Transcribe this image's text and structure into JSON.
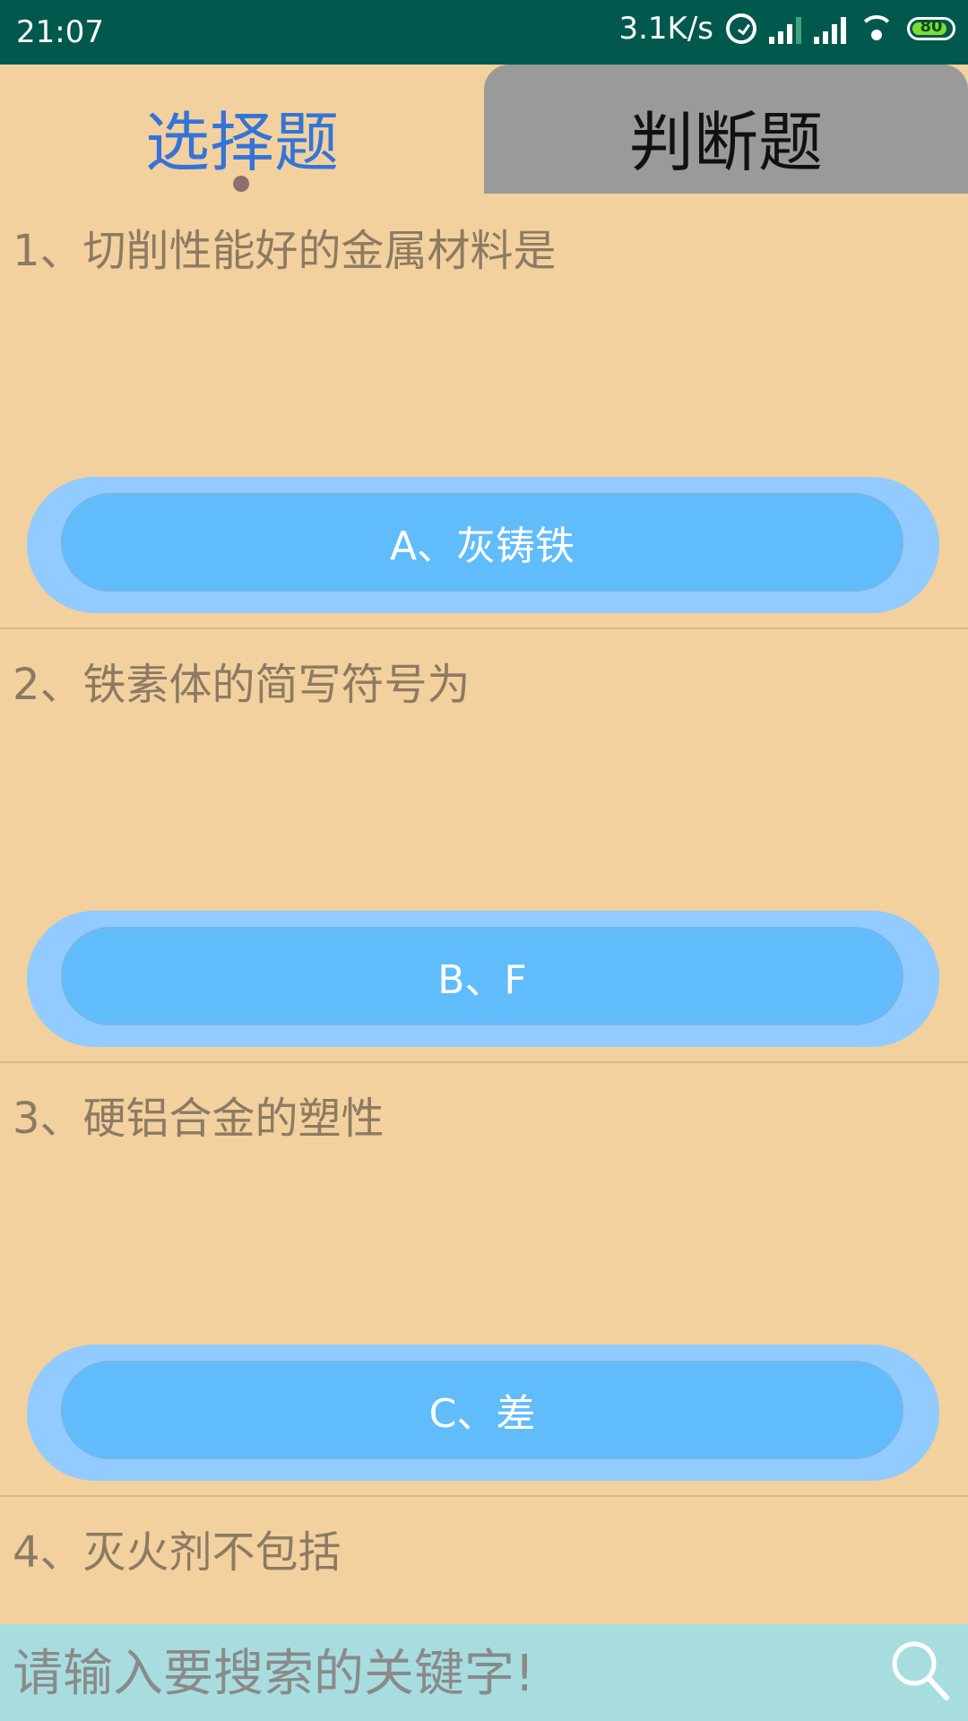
{
  "status_bar": {
    "time": "21:07",
    "network_speed": "3.1K/s",
    "battery": "80",
    "icons": [
      "alarm-icon",
      "signal-icon",
      "signal-icon",
      "wifi-icon",
      "battery-icon"
    ]
  },
  "tabs": [
    {
      "label": "选择题",
      "active": true
    },
    {
      "label": "判断题",
      "active": false
    }
  ],
  "questions": [
    {
      "text": "1、切削性能好的金属材料是",
      "answer": "A、灰铸铁"
    },
    {
      "text": "2、铁素体的简写符号为",
      "answer": "B、F"
    },
    {
      "text": "3、硬铝合金的塑性",
      "answer": "C、差"
    },
    {
      "text": "4、灭火剂不包括"
    }
  ],
  "search": {
    "placeholder": "请输入要搜索的关键字!"
  },
  "colors": {
    "status_bar": "#00594c",
    "background": "#f2d19e",
    "tab_active_text": "#3474d8",
    "tab_inactive_bg": "#9a9a9a",
    "answer_button": "#61bcfb",
    "search_bar": "#a8dde0"
  }
}
